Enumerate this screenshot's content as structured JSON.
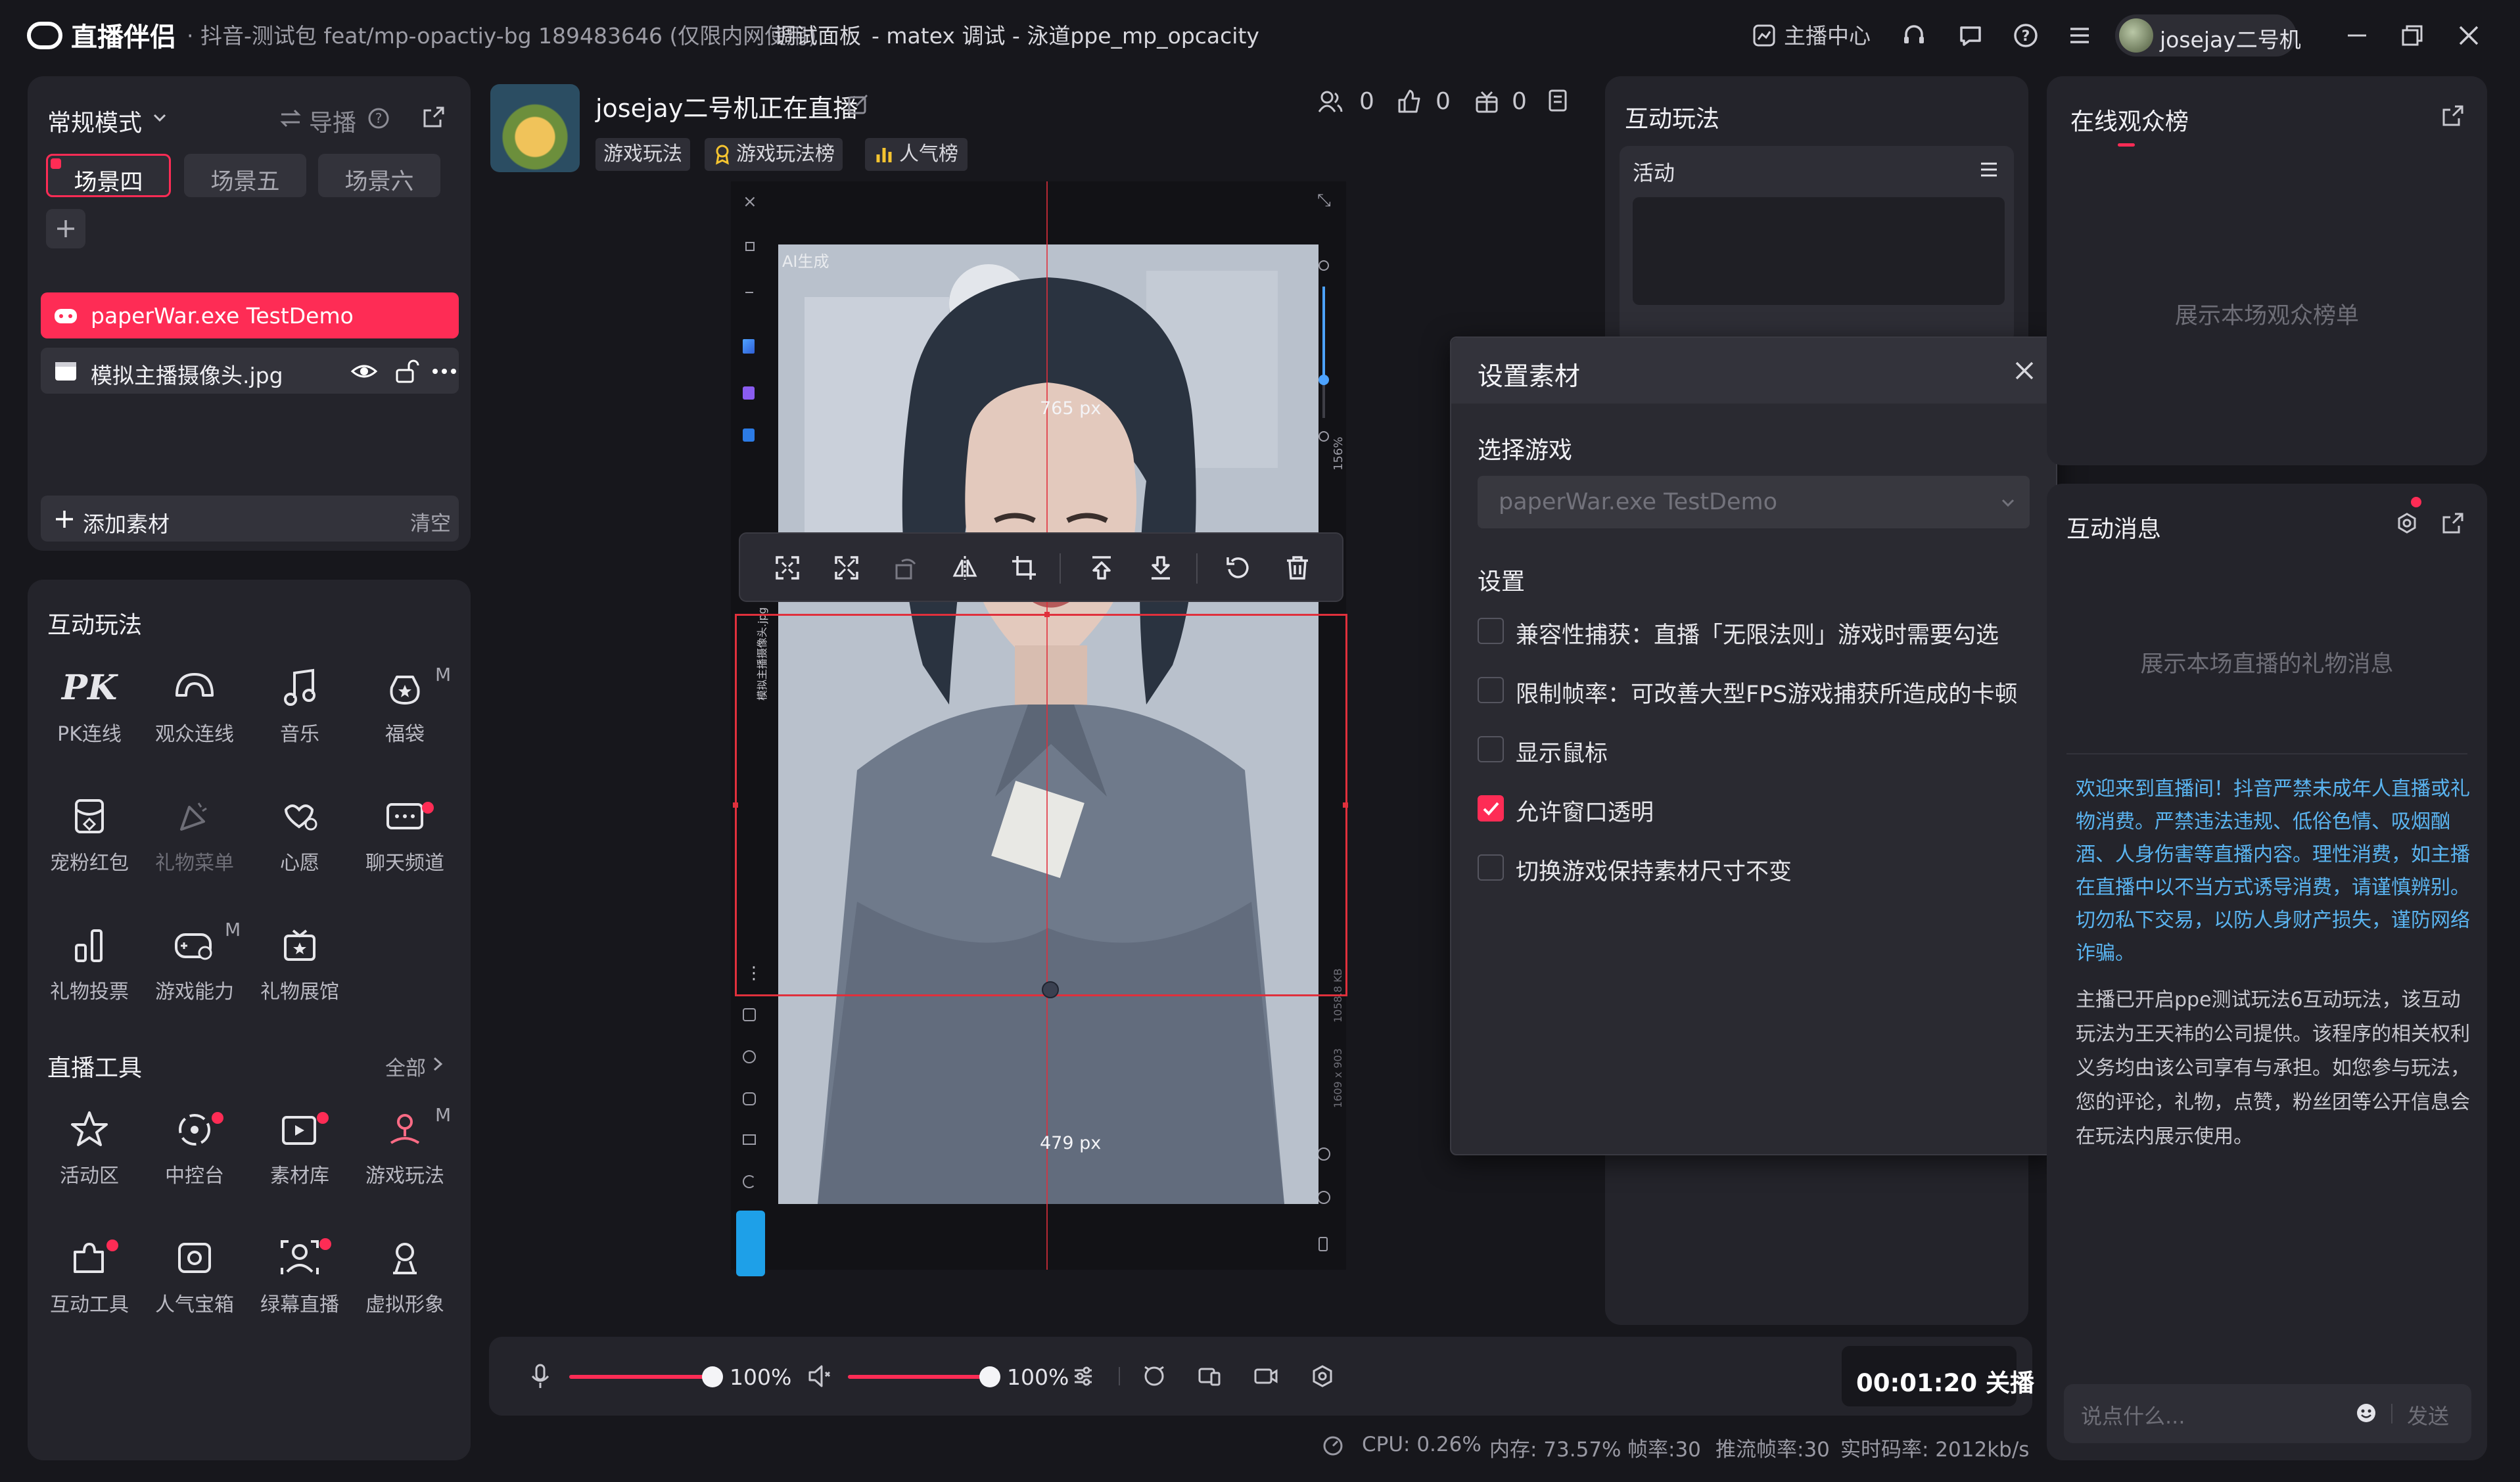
{
  "window": {
    "logo_text": "直播伴侣",
    "title_path": "· 抖音-测试包 feat/mp-opactiy-bg 189483646 (仅限内网使用)",
    "debug_panel": "调试面板",
    "debug_info": "- matex 调试 - 泳道ppe_mp_opcacity",
    "anchor_center": "主播中心",
    "username": "josejay二号机"
  },
  "left": {
    "mode": "常规模式",
    "guide": "导播",
    "scenes": [
      "场景四",
      "场景五",
      "场景六"
    ],
    "sources": [
      {
        "name": "paperWar.exe TestDemo",
        "active": true
      },
      {
        "name": "模拟主播摄像头.jpg",
        "active": false
      }
    ],
    "add_source": "添加素材",
    "clear": "清空",
    "interactive_title": "互动玩法",
    "interactive_items": [
      "PK连线",
      "观众连线",
      "音乐",
      "福袋",
      "宠粉红包",
      "礼物菜单",
      "心愿",
      "聊天频道",
      "礼物投票",
      "游戏能力",
      "礼物展馆"
    ],
    "tools_title": "直播工具",
    "tools_all": "全部",
    "tool_items": [
      "活动区",
      "中控台",
      "素材库",
      "游戏玩法",
      "互动工具",
      "人气宝箱",
      "绿幕直播",
      "虚拟形象"
    ],
    "badge_m": "M"
  },
  "stream": {
    "title": "josejay二号机正在直播",
    "tags": [
      "游戏玩法",
      "游戏玩法榜",
      "人气榜"
    ],
    "viewers": "0",
    "likes": "0",
    "gifts": "0"
  },
  "canvas": {
    "watermark": "AI生成",
    "dim_top": "765 px",
    "dim_bottom": "479 px",
    "zoom": "156%",
    "side_label": "模拟主播摄像头.jpg",
    "resolution": "1609 x 903",
    "size_label": "1058.8 KB"
  },
  "bottom": {
    "mic_volume": "100%",
    "speaker_volume": "100%",
    "timer": "00:01:20 关播",
    "mic_level": 1.0,
    "speaker_level": 1.0
  },
  "status": {
    "cpu": "CPU: 0.26%",
    "mem": "内存: 73.57%",
    "fps": "帧率:30",
    "push_fps": "推流帧率:30",
    "bitrate": "实时码率: 2012kb/s"
  },
  "interactive_panel": {
    "title": "互动玩法",
    "activity": "活动"
  },
  "dialog": {
    "title": "设置素材",
    "select_game_label": "选择游戏",
    "select_game_value": "paperWar.exe TestDemo",
    "settings_label": "设置",
    "options": [
      {
        "label": "兼容性捕获：直播「无限法则」游戏时需要勾选",
        "checked": false
      },
      {
        "label": "限制帧率：可改善大型FPS游戏捕获所造成的卡顿",
        "checked": false
      },
      {
        "label": "显示鼠标",
        "checked": false
      },
      {
        "label": "允许窗口透明",
        "checked": true
      },
      {
        "label": "切换游戏保持素材尺寸不变",
        "checked": false
      }
    ]
  },
  "right": {
    "audience_title": "在线观众榜",
    "audience_empty": "展示本场观众榜单",
    "messages_title": "互动消息",
    "messages_empty": "展示本场直播的礼物消息",
    "notice": "欢迎来到直播间！抖音严禁未成年人直播或礼物消费。严禁违法违规、低俗色情、吸烟酗酒、人身伤害等直播内容。理性消费，如主播在直播中以不当方式诱导消费，请谨慎辨别。切勿私下交易，以防人身财产损失，谨防网络诈骗。",
    "system_msg": "主播已开启ppe测试玩法6互动玩法，该互动玩法为王天祎的公司提供。该程序的相关权利义务均由该公司享有与承担。如您参与玩法，您的评论，礼物，点赞，粉丝团等公开信息会在玩法内展示使用。",
    "input_placeholder": "说点什么...",
    "send": "发送"
  },
  "colors": {
    "accent": "#fe2c55",
    "link": "#5ab4f0",
    "panel": "#24242b",
    "bg": "#17171c"
  }
}
